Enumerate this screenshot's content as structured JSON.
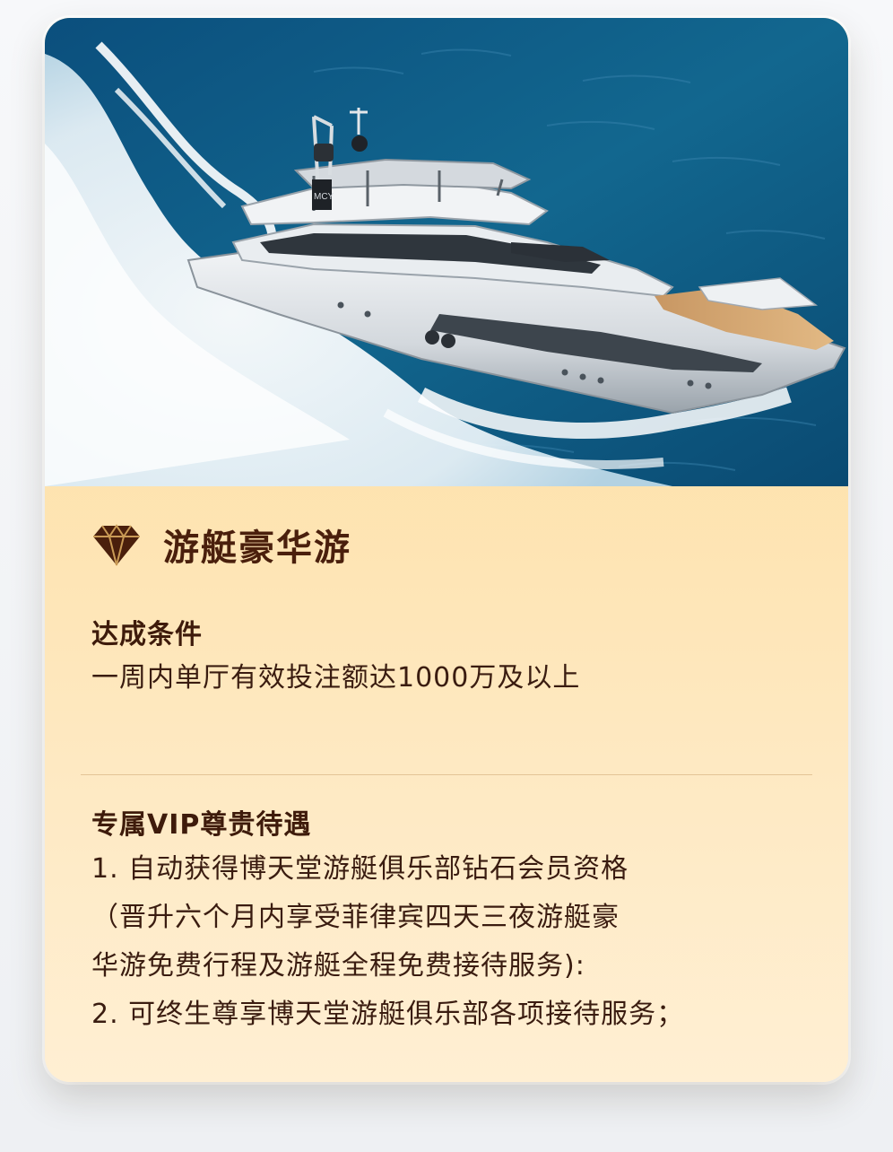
{
  "card": {
    "title": "游艇豪华游",
    "title_icon": "diamond-icon",
    "colors": {
      "background_top": "#fdd489",
      "background_bottom": "#ffefd3",
      "title": "#4a1f0c",
      "text": "#3a1c10",
      "sea": "#0f5e8c"
    }
  },
  "conditions": {
    "heading": "达成条件",
    "text": "一周内单厅有效投注额达1000万及以上"
  },
  "benefits": {
    "heading": "专属VIP尊贵待遇",
    "lines": [
      "1. 自动获得博天堂游艇俱乐部钻石会员资格",
      "（晋升六个月内享受菲律宾四天三夜游艇豪",
      "华游免费行程及游艇全程免费接待服务):",
      "2. 可终生尊享博天堂游艇俱乐部各项接待服务；"
    ]
  }
}
